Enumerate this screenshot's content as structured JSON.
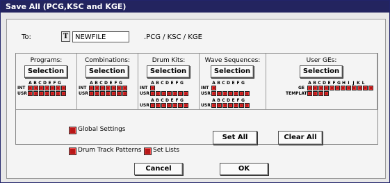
{
  "title": "Save All (PCG,KSC and KGE)",
  "to": {
    "label": "To:",
    "text_button": "T",
    "filename": "NEWFILE",
    "extensions": ".PCG / KSC / KGE"
  },
  "columns": [
    {
      "title": "Programs:",
      "button": "Selection",
      "letters": "ABCDEFG",
      "rows": [
        {
          "label": "INT",
          "count": 7
        },
        {
          "label": "USR",
          "count": 7
        }
      ]
    },
    {
      "title": "Combinations:",
      "button": "Selection",
      "letters": "ABCDEFG",
      "rows": [
        {
          "label": "INT",
          "count": 7
        },
        {
          "label": "USR",
          "count": 7
        }
      ]
    },
    {
      "title": "Drum Kits:",
      "button": "Selection",
      "letters": "ABCDEFG",
      "rows": [
        {
          "label": "INT",
          "count": 1
        },
        {
          "label": "USR",
          "count": 7
        }
      ],
      "extra_letters": "ABCDEFG",
      "extra_rows": [
        {
          "label": "USR",
          "count": 7
        }
      ]
    },
    {
      "title": "Wave Sequences:",
      "button": "Selection",
      "letters": "ABCDEFG",
      "rows": [
        {
          "label": "INT",
          "count": 1
        },
        {
          "label": "USR",
          "count": 7
        }
      ],
      "extra_letters": "ABCDEFG",
      "extra_rows": [
        {
          "label": "USR",
          "count": 7
        }
      ]
    },
    {
      "title": "User GEs:",
      "button": "Selection",
      "letters": "ABCDEFGHIJKL",
      "rows": [
        {
          "label": "GE",
          "count": 12
        },
        {
          "label": "TEMPLATE",
          "count": 4
        }
      ]
    }
  ],
  "options": {
    "global_settings": "Global Settings",
    "drum_track_patterns": "Drum Track Patterns",
    "set_lists": "Set Lists"
  },
  "buttons": {
    "set_all": "Set All",
    "clear_all": "Clear All",
    "cancel": "Cancel",
    "ok": "OK"
  },
  "colors": {
    "titlebar": "#23245f",
    "checkbox_red": "#b81818"
  }
}
